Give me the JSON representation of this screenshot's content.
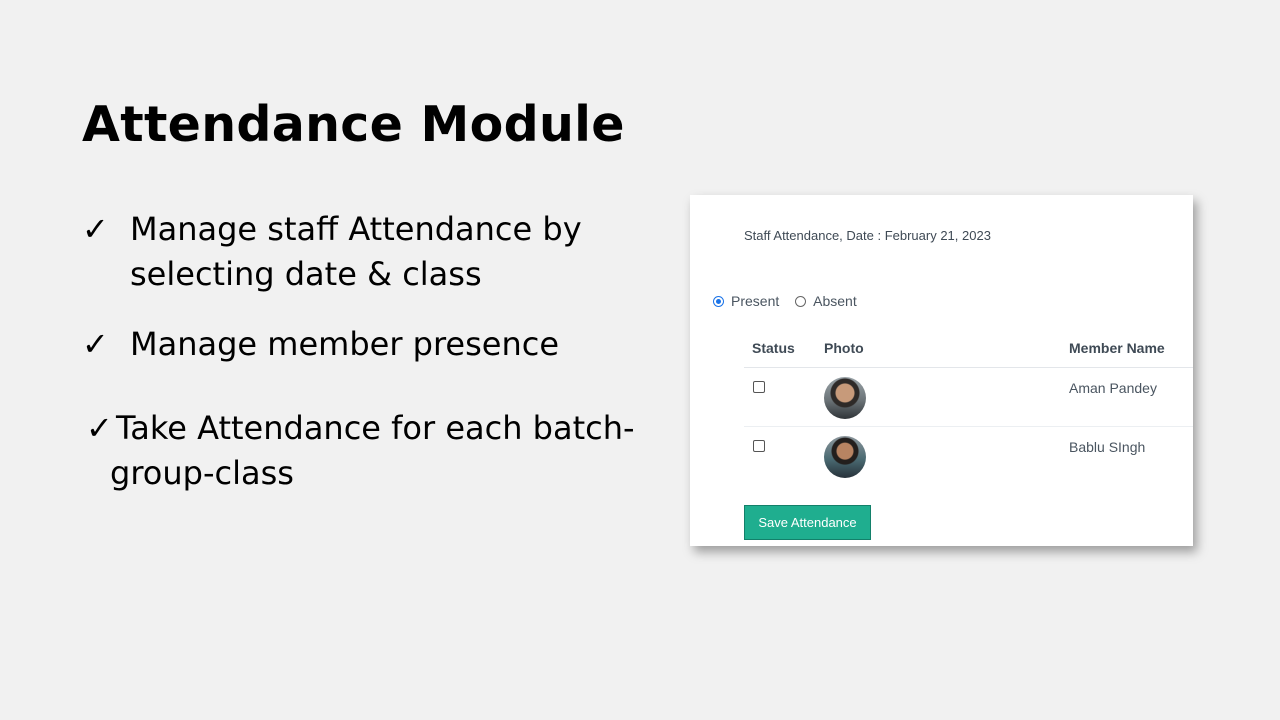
{
  "slide": {
    "title": "Attendance Module",
    "bullets": [
      {
        "check": "✓",
        "line1": "Manage staff Attendance by",
        "line2": "selecting date & class"
      },
      {
        "check": "✓",
        "line1": "Manage member presence"
      },
      {
        "check": "✓",
        "line1": "Take Attendance for each batch-",
        "line2": "group-class"
      }
    ]
  },
  "screenshot": {
    "heading": "Staff Attendance, Date : February 21, 2023",
    "radios": [
      {
        "label": "Present",
        "checked": true
      },
      {
        "label": "Absent",
        "checked": false
      }
    ],
    "columns": {
      "status": "Status",
      "photo": "Photo",
      "member_name": "Member Name"
    },
    "rows": [
      {
        "member_name": "Aman Pandey",
        "checked": false
      },
      {
        "member_name": "Bablu SIngh",
        "checked": false
      }
    ],
    "save_button": "Save Attendance",
    "colors": {
      "accent": "#1fae8f",
      "radio": "#1a73e8"
    }
  }
}
